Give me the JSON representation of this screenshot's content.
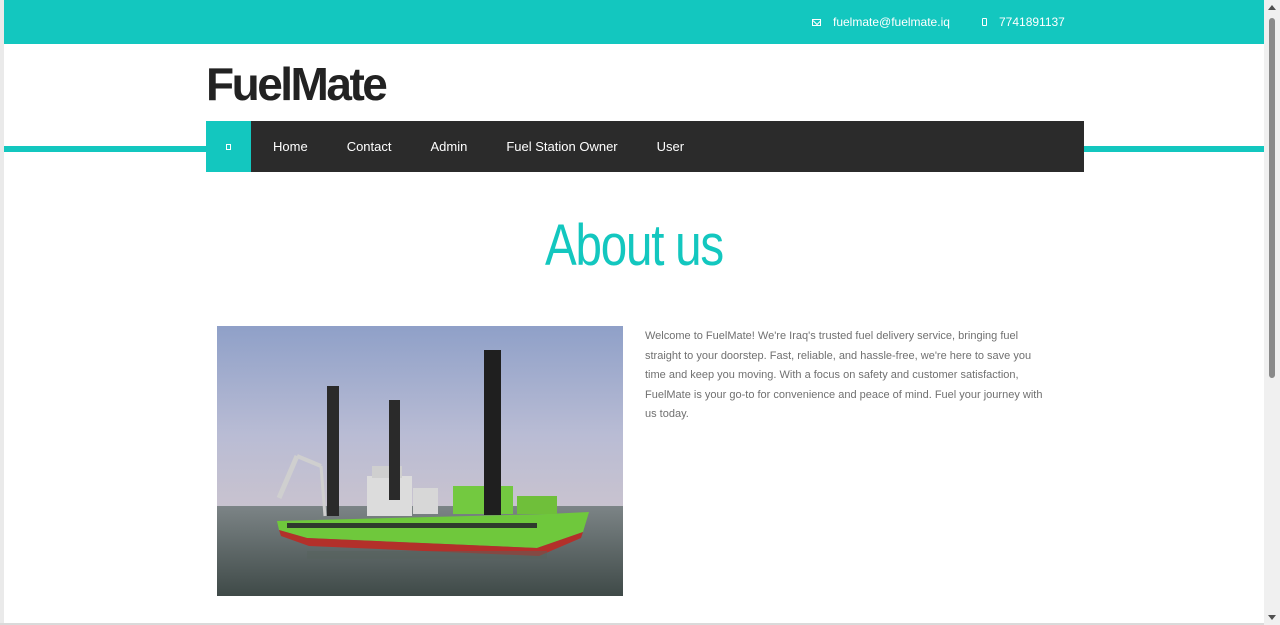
{
  "topbar": {
    "email": "fuelmate@fuelmate.iq",
    "phone": "7741891137"
  },
  "brand": {
    "name": "FuelMate"
  },
  "nav": {
    "home_icon": "home-icon",
    "items": [
      {
        "label": "Home"
      },
      {
        "label": "Contact"
      },
      {
        "label": "Admin"
      },
      {
        "label": "Fuel Station Owner"
      },
      {
        "label": "User"
      }
    ]
  },
  "about": {
    "title": "About us",
    "text": "Welcome to FuelMate! We're Iraq's trusted fuel delivery service, bringing fuel straight to your doorstep. Fast, reliable, and hassle-free, we're here to save you time and keep you moving. With a focus on safety and customer satisfaction, FuelMate is your go-to for convenience and peace of mind. Fuel your journey with us today."
  },
  "colors": {
    "accent": "#13c7bf",
    "nav_bg": "#2b2b2b",
    "brand": "#222222"
  }
}
